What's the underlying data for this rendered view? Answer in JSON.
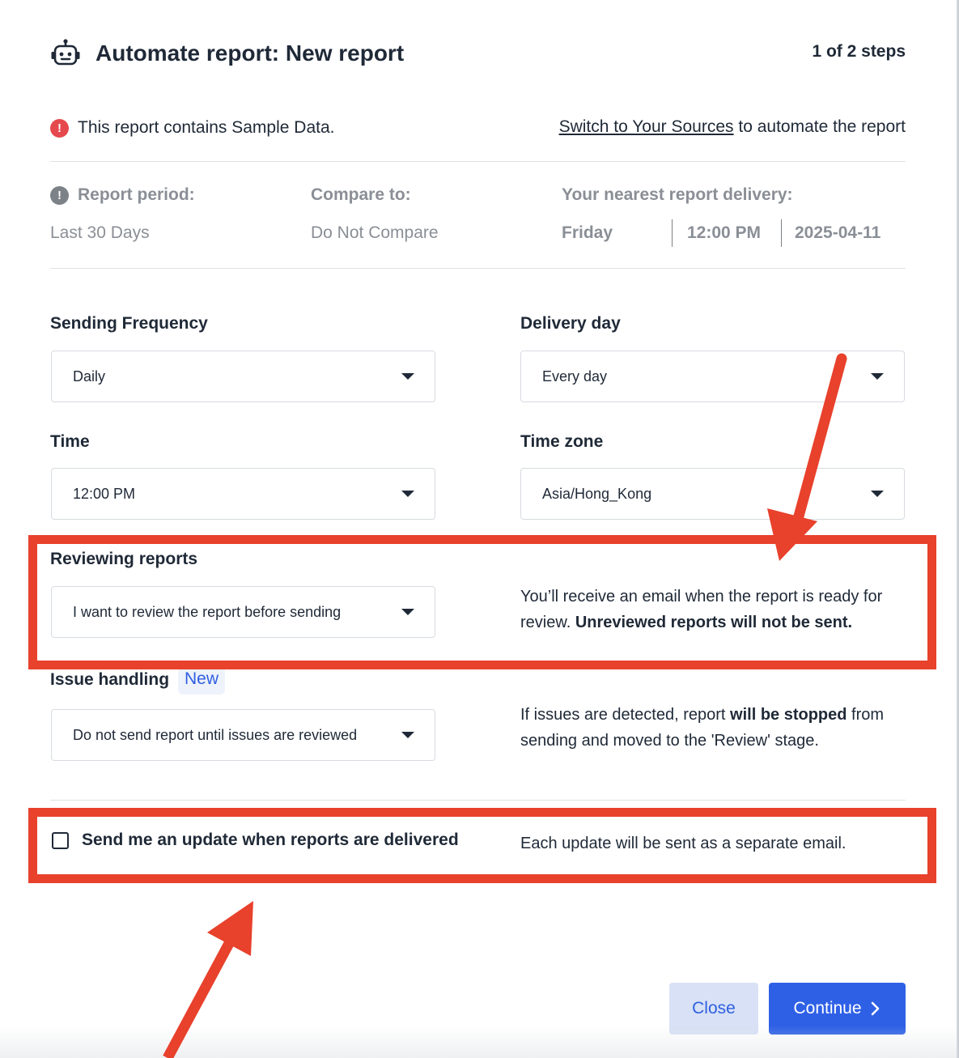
{
  "header": {
    "title": "Automate report: New report",
    "steps": "1 of 2 steps",
    "icon": "robot-icon"
  },
  "sample_notice": {
    "text": "This report contains Sample Data.",
    "link": "Switch to Your Sources",
    "link_suffix": " to automate the report",
    "icon": "alert-icon"
  },
  "summary": {
    "report_period_label": "Report period:",
    "report_period_value": "Last 30 Days",
    "compare_label": "Compare to:",
    "compare_value": "Do Not Compare",
    "delivery_label": "Your nearest report delivery:",
    "delivery_day": "Friday",
    "delivery_time": "12:00 PM",
    "delivery_date": "2025-04-11"
  },
  "form": {
    "frequency_label": "Sending Frequency",
    "frequency_value": "Daily",
    "delivery_day_label": "Delivery day",
    "delivery_day_value": "Every day",
    "time_label": "Time",
    "time_value": "12:00 PM",
    "timezone_label": "Time zone",
    "timezone_value": "Asia/Hong_Kong",
    "reviewing_label": "Reviewing reports",
    "reviewing_value": "I want to review the report before sending",
    "reviewing_help_plain": "You’ll receive an email when the report is ready for review. ",
    "reviewing_help_bold": "Unreviewed reports will not be sent.",
    "issue_label": "Issue handling",
    "issue_badge": "New",
    "issue_value": "Do not send report until issues are reviewed",
    "issue_help_plain1": "If issues are detected, report ",
    "issue_help_bold": "will be stopped",
    "issue_help_plain2": " from sending and moved to the 'Review' stage."
  },
  "update_option": {
    "label": "Send me an update when reports are delivered",
    "help": "Each update will be sent as a separate email.",
    "checked": false
  },
  "footer": {
    "close_label": "Close",
    "continue_label": "Continue"
  },
  "colors": {
    "accent": "#2e60e6",
    "annotation": "#e8412c",
    "error": "#e5484d"
  }
}
